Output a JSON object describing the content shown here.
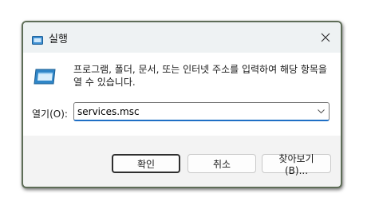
{
  "window": {
    "title": "실행",
    "title_icon": "run-window-icon",
    "close_icon": "close-icon"
  },
  "content": {
    "icon": "run-program-icon",
    "description": "프로그램, 폴더, 문서, 또는 인터넷 주소를 입력하여 해당 항목을 열 수 있습니다.",
    "open_label": "열기(O):",
    "input_value": "services.msc",
    "dropdown_icon": "chevron-down-icon"
  },
  "buttons": {
    "ok": "확인",
    "cancel": "취소",
    "browse": "찾아보기(B)..."
  }
}
